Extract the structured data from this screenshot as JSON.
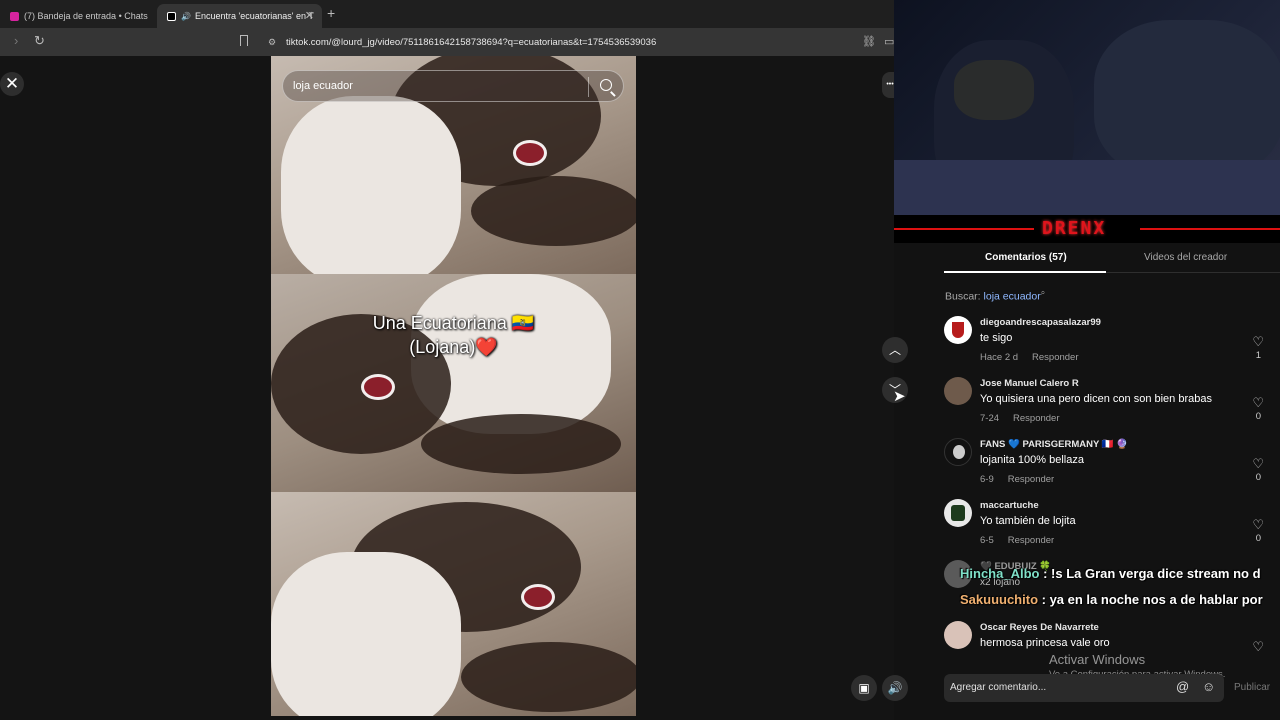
{
  "browser": {
    "tabs": [
      {
        "title": "(7) Bandeja de entrada • Chats",
        "active": false
      },
      {
        "title": "Encuentra 'ecuatorianas' en T",
        "active": true
      }
    ],
    "new_tab": "+",
    "url": "tiktok.com/@lourd_jg/video/7511861642158738694?q=ecuatorianas&t=1754536539036"
  },
  "player": {
    "close": "✕",
    "search_query": "loja ecuador",
    "caption_line1": "Una Ecuatoriana 🇪🇨",
    "caption_line2": "(Lojana)❤️",
    "nav_up": "︿",
    "nav_down": "﹀",
    "more": "•••"
  },
  "streamer": {
    "name": "DRENX"
  },
  "sidebar": {
    "tab_comments": "Comentarios (57)",
    "tab_creator": "Videos del creador",
    "search_label": "Buscar: ",
    "search_keyword": "loja ecuador",
    "comments": [
      {
        "user": "diegoandrescapasalazar99",
        "text": "te sigo",
        "time": "Hace 2 d",
        "reply": "Responder",
        "likes": "1"
      },
      {
        "user": "Jose Manuel Calero R",
        "text": "Yo quisiera una pero dicen con son bien brabas",
        "time": "7-24",
        "reply": "Responder",
        "likes": "0"
      },
      {
        "user": "FANS 💙 PARISGERMANY 🇫🇷 🔮",
        "text": "lojanita 100% bellaza",
        "time": "6-9",
        "reply": "Responder",
        "likes": "0"
      },
      {
        "user": "maccartuche",
        "text": "Yo también de lojita",
        "time": "6-5",
        "reply": "Responder",
        "likes": "0"
      },
      {
        "user": "🖤 EDUBUIZ 🍀",
        "text": "x2 lojano",
        "time": "",
        "reply": "",
        "likes": ""
      },
      {
        "user": "Oscar Reyes De Navarrete",
        "text": "hermosa princesa vale oro",
        "time": "",
        "reply": "",
        "likes": ""
      }
    ],
    "compose_placeholder": "Agregar comentario...",
    "publish": "Publicar"
  },
  "stream_chat": [
    {
      "user": "Hincha_Albo",
      "message": " : !s La Gran verga dice stream no d",
      "color": "#7fe0c8"
    },
    {
      "user": "Sakuuuchito",
      "message": " : ya en la noche nos a de hablar por",
      "color": "#f0b070"
    }
  ],
  "windows": {
    "activate_title": "Activar Windows",
    "activate_sub": "Ve a Configuración para activar Windows."
  }
}
